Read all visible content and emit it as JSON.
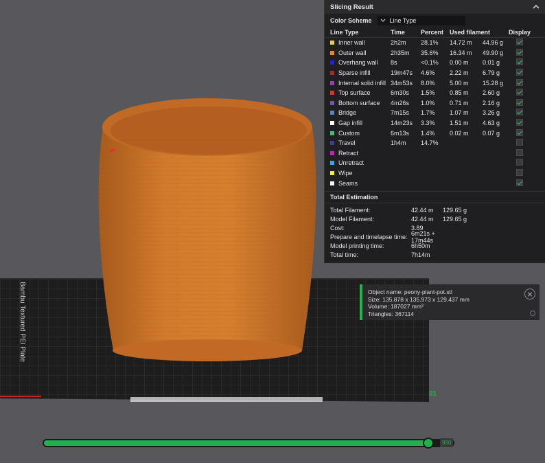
{
  "panel": {
    "title": "Slicing Result",
    "color_scheme_label": "Color Scheme",
    "color_scheme_value": "Line Type",
    "columns": [
      "Line Type",
      "Time",
      "Percent",
      "Used filament",
      "Display"
    ],
    "rows": [
      {
        "color": "#f2d22e",
        "name": "Inner wall",
        "time": "2h2m",
        "percent": "28.1%",
        "length": "14.72 m",
        "weight": "44.96 g",
        "display": true
      },
      {
        "color": "#e9882a",
        "name": "Outer wall",
        "time": "2h35m",
        "percent": "35.6%",
        "length": "16.34 m",
        "weight": "49.90 g",
        "display": true
      },
      {
        "color": "#2222d8",
        "name": "Overhang wall",
        "time": "8s",
        "percent": "<0.1%",
        "length": "0.00 m",
        "weight": "0.01 g",
        "display": true
      },
      {
        "color": "#a52b2b",
        "name": "Sparse infill",
        "time": "19m47s",
        "percent": "4.6%",
        "length": "2.22 m",
        "weight": "6.79 g",
        "display": true
      },
      {
        "color": "#9b3fb8",
        "name": "Internal solid infill",
        "time": "34m53s",
        "percent": "8.0%",
        "length": "5.00 m",
        "weight": "15.28 g",
        "display": true
      },
      {
        "color": "#e0302f",
        "name": "Top surface",
        "time": "6m30s",
        "percent": "1.5%",
        "length": "0.85 m",
        "weight": "2.60 g",
        "display": true
      },
      {
        "color": "#6d5aa8",
        "name": "Bottom surface",
        "time": "4m26s",
        "percent": "1.0%",
        "length": "0.71 m",
        "weight": "2.16 g",
        "display": true
      },
      {
        "color": "#5a86c8",
        "name": "Bridge",
        "time": "7m15s",
        "percent": "1.7%",
        "length": "1.07 m",
        "weight": "3.26 g",
        "display": true
      },
      {
        "color": "#ffffff",
        "name": "Gap infill",
        "time": "14m23s",
        "percent": "3.3%",
        "length": "1.51 m",
        "weight": "4.63 g",
        "display": true
      },
      {
        "color": "#3fbf7f",
        "name": "Custom",
        "time": "6m13s",
        "percent": "1.4%",
        "length": "0.02 m",
        "weight": "0.07 g",
        "display": true
      },
      {
        "color": "#3a3f9a",
        "name": "Travel",
        "time": "1h4m",
        "percent": "14.7%",
        "length": "",
        "weight": "",
        "display": false
      },
      {
        "color": "#c521c2",
        "name": "Retract",
        "time": "",
        "percent": "",
        "length": "",
        "weight": "",
        "display": false
      },
      {
        "color": "#3da6d8",
        "name": "Unretract",
        "time": "",
        "percent": "",
        "length": "",
        "weight": "",
        "display": false
      },
      {
        "color": "#f5f020",
        "name": "Wipe",
        "time": "",
        "percent": "",
        "length": "",
        "weight": "",
        "display": false
      },
      {
        "color": "#f2f2f2",
        "name": "Seams",
        "time": "",
        "percent": "",
        "length": "",
        "weight": "",
        "display": true
      }
    ],
    "total_title": "Total Estimation",
    "totals": [
      {
        "label": "Total Filament:",
        "v1": "42.44 m",
        "v2": "129.65 g"
      },
      {
        "label": "Model Filament:",
        "v1": "42.44 m",
        "v2": "129.65 g"
      },
      {
        "label": "Cost:",
        "v1": "3.89",
        "v2": ""
      },
      {
        "label": "Prepare and timelapse time:",
        "v1": "6m21s + 17m44s",
        "v2": ""
      },
      {
        "label": "Model printing time:",
        "v1": "6h50m",
        "v2": ""
      },
      {
        "label": "Total time:",
        "v1": "7h14m",
        "v2": ""
      }
    ]
  },
  "object_info": {
    "name": "Object name: peony-plant-pot.stl",
    "size": "Size: 135.878 x 135.973 x 129.437 mm",
    "volume": "Volume: 187027 mm³",
    "triangles": "Triangles: 367114"
  },
  "plate": {
    "brand_text": "Bambu Textured PEI Plate",
    "number": "01"
  },
  "slider": {
    "value": "990",
    "fraction": 0.94
  },
  "colors": {
    "accent": "#22b14c",
    "model": "#d2782a",
    "background": "#58585c"
  }
}
